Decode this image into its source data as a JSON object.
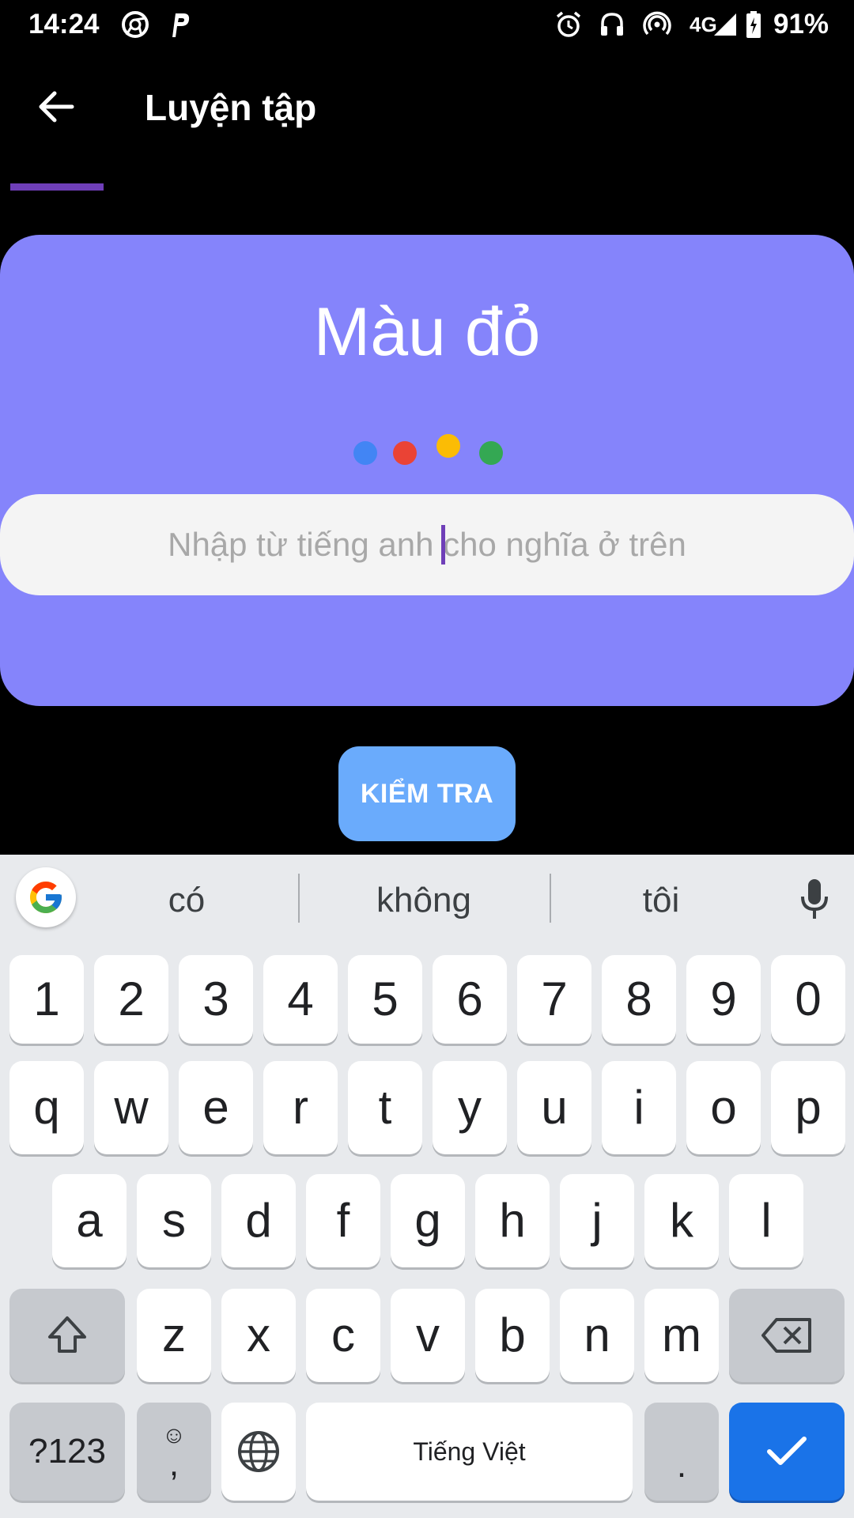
{
  "status_bar": {
    "time": "14:24",
    "network": "4G",
    "battery": "91%",
    "left_icons": [
      "chrome-icon",
      "parking-icon"
    ],
    "right_icons": [
      "alarm-icon",
      "headset-icon",
      "hotspot-icon",
      "signal-icon",
      "battery-icon"
    ]
  },
  "app_bar": {
    "title": "Luyện tập",
    "back_icon": "arrow-back-icon"
  },
  "card": {
    "word": "Màu đỏ",
    "input_placeholder": "Nhập từ tiếng anh cho nghĩa ở trên",
    "input_value": "",
    "dot_colors": [
      "#4285f4",
      "#ea4335",
      "#fbbc05",
      "#34a853"
    ]
  },
  "check_button": {
    "label": "KIỂM TRA"
  },
  "keyboard": {
    "suggestions": [
      "có",
      "không",
      "tôi"
    ],
    "number_row": [
      "1",
      "2",
      "3",
      "4",
      "5",
      "6",
      "7",
      "8",
      "9",
      "0"
    ],
    "row1": [
      "q",
      "w",
      "e",
      "r",
      "t",
      "y",
      "u",
      "i",
      "o",
      "p"
    ],
    "row2": [
      "a",
      "s",
      "d",
      "f",
      "g",
      "h",
      "j",
      "k",
      "l"
    ],
    "row3": [
      "z",
      "x",
      "c",
      "v",
      "b",
      "n",
      "m"
    ],
    "symbols_label": "?123",
    "comma_label": ",",
    "emoji_label": "☺",
    "space_label": "Tiếng Việt",
    "period_label": "."
  },
  "colors": {
    "accent": "#6f3fb8",
    "card": "#8584fb",
    "button": "#6aabfc",
    "keyboard_bg": "#e8eaed",
    "enter_key": "#1a73e8"
  }
}
